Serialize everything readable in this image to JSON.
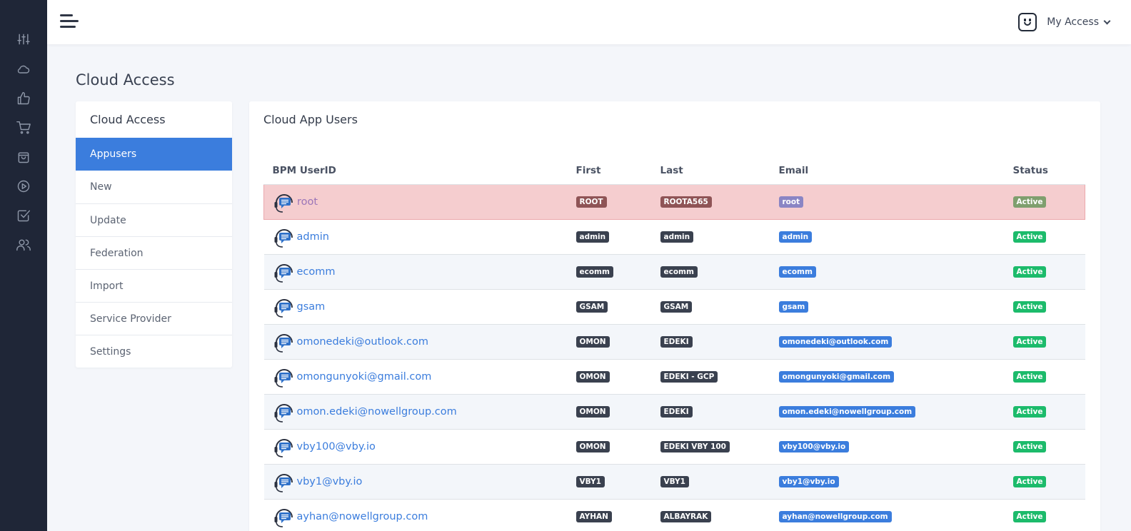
{
  "rail": {
    "items": [
      {
        "name": "sliders-icon"
      },
      {
        "name": "cloud-icon"
      },
      {
        "name": "thumbs-up-icon"
      },
      {
        "name": "cart-icon"
      },
      {
        "name": "shopping-bag-icon"
      },
      {
        "name": "play-circle-icon"
      },
      {
        "name": "check-square-icon"
      },
      {
        "name": "users-icon"
      }
    ]
  },
  "topbar": {
    "user_label": "My Access"
  },
  "page": {
    "title": "Cloud Access"
  },
  "side_menu": {
    "header": "Cloud Access",
    "items": [
      {
        "label": "Appusers",
        "active": true
      },
      {
        "label": "New"
      },
      {
        "label": "Update"
      },
      {
        "label": "Federation"
      },
      {
        "label": "Import"
      },
      {
        "label": "Service Provider"
      },
      {
        "label": "Settings"
      }
    ]
  },
  "users_card": {
    "title": "Cloud App Users",
    "columns": [
      "BPM UserID",
      "First",
      "Last",
      "Email",
      "Status"
    ],
    "rows": [
      {
        "user_id": "root",
        "first": "ROOT",
        "last": "ROOTA565",
        "email": "root",
        "status": "Active",
        "highlight": true
      },
      {
        "user_id": "admin",
        "first": "admin",
        "last": "admin",
        "email": "admin",
        "status": "Active"
      },
      {
        "user_id": "ecomm",
        "first": "ecomm",
        "last": "ecomm",
        "email": "ecomm",
        "status": "Active"
      },
      {
        "user_id": "gsam",
        "first": "GSAM",
        "last": "GSAM",
        "email": "gsam",
        "status": "Active"
      },
      {
        "user_id": "omonedeki@outlook.com",
        "first": "OMON",
        "last": "EDEKI",
        "email": "omonedeki@outlook.com",
        "status": "Active"
      },
      {
        "user_id": "omongunyoki@gmail.com",
        "first": "OMON",
        "last": "EDEKI - GCP",
        "email": "omongunyoki@gmail.com",
        "status": "Active"
      },
      {
        "user_id": "omon.edeki@nowellgroup.com",
        "first": "OMON",
        "last": "EDEKI",
        "email": "omon.edeki@nowellgroup.com",
        "status": "Active"
      },
      {
        "user_id": "vby100@vby.io",
        "first": "OMON",
        "last": "EDEKI VBY 100",
        "email": "vby100@vby.io",
        "status": "Active"
      },
      {
        "user_id": "vby1@vby.io",
        "first": "VBY1",
        "last": "VBY1",
        "email": "vby1@vby.io",
        "status": "Active"
      },
      {
        "user_id": "ayhan@nowellgroup.com",
        "first": "AYHAN",
        "last": "ALBAYRAK",
        "email": "ayhan@nowellgroup.com",
        "status": "Active"
      }
    ]
  },
  "colors": {
    "rail_bg": "#1f2637",
    "accent": "#3b7ddd",
    "badge_dark": "#3a414f",
    "badge_success": "#1cbb6b",
    "row_danger": "#f5cdcf"
  }
}
